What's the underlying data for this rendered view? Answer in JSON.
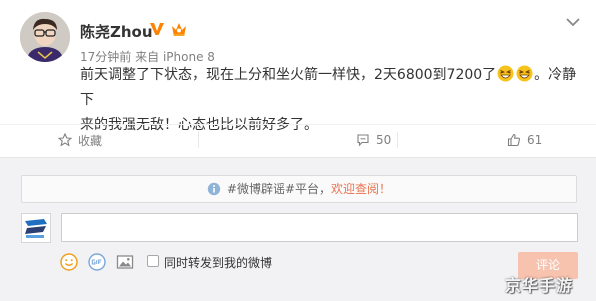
{
  "post": {
    "username": "陈尧Zhou",
    "time": "17分钟前",
    "source_prefix": "来自",
    "source": "iPhone 8",
    "content_line1_a": "前天调整了下状态，现在上分和坐火箭一样快，2天6800到7200了",
    "content_line1_b": "。冷静下",
    "content_line2": "来的我强无敌！心态也比以前好多了。",
    "icons": {
      "verified": "verified-v-icon",
      "level": "member-level-icon",
      "more": "chevron-down-icon",
      "emoji": "laughing-emoji-icon"
    }
  },
  "actions": {
    "collect_label": "收藏",
    "comment_count": "50",
    "like_count": "61"
  },
  "comment": {
    "notice_prefix": "#微博辟谣#平台，",
    "notice_link": "欢迎查阅！",
    "repost_label": "同时转发到我的微博",
    "submit_label": "评论",
    "input_value": "",
    "repost_checked": false
  },
  "watermark": "京华手游",
  "colors": {
    "accent_orange": "#eb7350",
    "submit_bg": "#f7c3af",
    "badge_orange": "#ff8200",
    "panel_bg": "#f2f2f5",
    "muted_text": "#808080"
  }
}
